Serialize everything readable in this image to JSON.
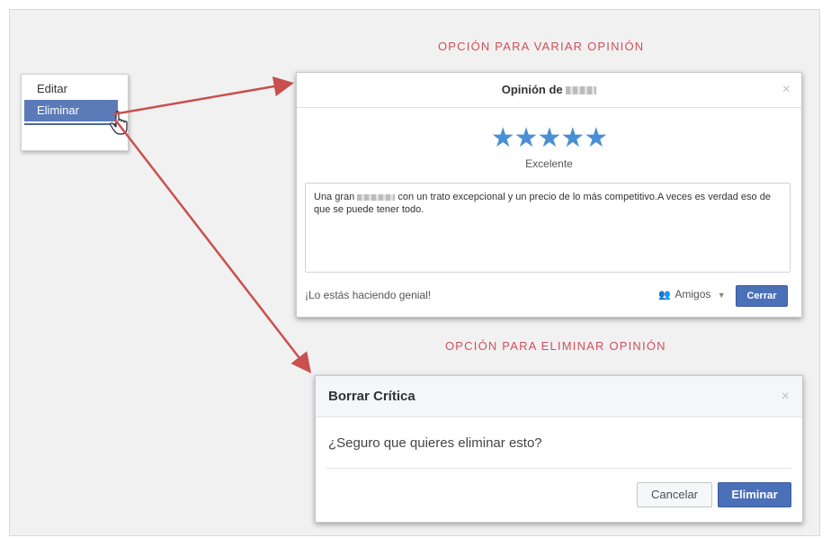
{
  "captions": {
    "edit": "OPCIÓN PARA VARIAR OPINIÓN",
    "delete": "OPCIÓN PARA ELIMINAR OPINIÓN"
  },
  "context_menu": {
    "items": [
      {
        "label": "Editar",
        "selected": false
      },
      {
        "label": "Eliminar",
        "selected": true
      }
    ]
  },
  "review_dialog": {
    "title_prefix": "Opinión de",
    "close_glyph": "×",
    "stars": "★★★★★",
    "star_count": 5,
    "rating_label": "Excelente",
    "text_a": "Una gran",
    "text_b": "con un trato excepcional y un precio de lo más competitivo.A veces es verdad eso de que se puede tener todo.",
    "encouragement": "¡Lo estás haciendo genial!",
    "audience_icon": "👥",
    "audience_label": "Amigos",
    "audience_caret": "▼",
    "close_button": "Cerrar"
  },
  "delete_dialog": {
    "title": "Borrar Crítica",
    "close_glyph": "×",
    "question": "¿Seguro que quieres eliminar esto?",
    "cancel_button": "Cancelar",
    "confirm_button": "Eliminar"
  },
  "colors": {
    "caption": "#d0505a",
    "arrow": "#c9504f",
    "primary_button": "#4a70b8",
    "stars": "#4a8fd3",
    "menu_selected": "#5b7bb8"
  }
}
